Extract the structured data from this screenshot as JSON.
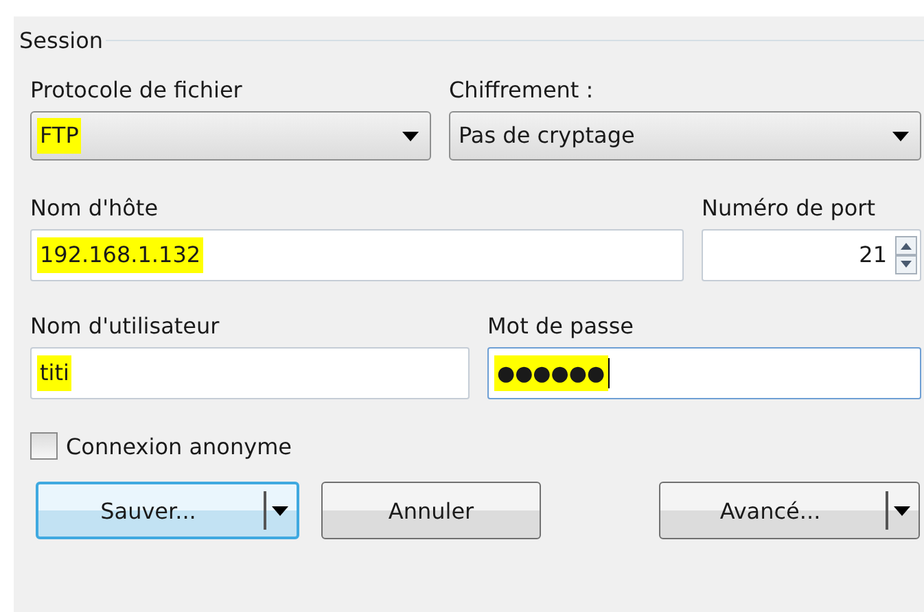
{
  "group": {
    "title": "Session"
  },
  "protocol": {
    "label": "Protocole de fichier",
    "value": "FTP",
    "highlighted": true
  },
  "encryption": {
    "label": "Chiffrement :",
    "value": "Pas de cryptage",
    "highlighted": false
  },
  "host": {
    "label": "Nom d'hôte",
    "value": "192.168.1.132",
    "highlighted": true
  },
  "port": {
    "label": "Numéro de port",
    "value": "21"
  },
  "user": {
    "label": "Nom d'utilisateur",
    "value": "titi",
    "highlighted": true
  },
  "password": {
    "label": "Mot de passe",
    "value": "●●●●●●",
    "highlighted": true,
    "focused": true
  },
  "anonymous": {
    "label": "Connexion anonyme",
    "checked": false
  },
  "buttons": [
    {
      "label": "Sauver...",
      "kind": "split",
      "default": true
    },
    {
      "label": "Annuler",
      "kind": "plain",
      "default": false
    },
    {
      "label": "Avancé...",
      "kind": "split",
      "default": false
    }
  ]
}
